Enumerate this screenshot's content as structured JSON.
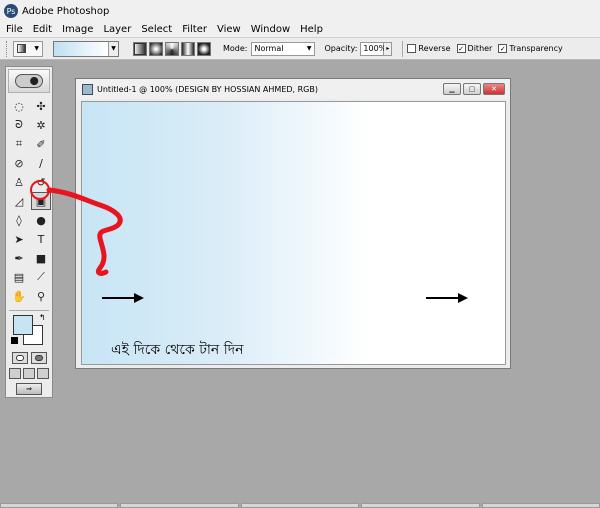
{
  "app": {
    "title": "Adobe Photoshop",
    "icon_label": "Ps"
  },
  "menu": [
    {
      "label": "File"
    },
    {
      "label": "Edit"
    },
    {
      "label": "Image"
    },
    {
      "label": "Layer"
    },
    {
      "label": "Select"
    },
    {
      "label": "Filter"
    },
    {
      "label": "View"
    },
    {
      "label": "Window"
    },
    {
      "label": "Help"
    }
  ],
  "options": {
    "mode_label": "Mode:",
    "mode_value": "Normal",
    "opacity_label": "Opacity:",
    "opacity_value": "100%",
    "reverse_label": "Reverse",
    "reverse_checked": false,
    "dither_label": "Dither",
    "dither_checked": true,
    "transparency_label": "Transparency",
    "transparency_checked": true,
    "gradient_colors": [
      "#bfe0f2",
      "#ffffff"
    ]
  },
  "toolbox": {
    "tools": [
      {
        "name": "marquee-tool-icon",
        "glyph": "◌"
      },
      {
        "name": "move-tool-icon",
        "glyph": "✣"
      },
      {
        "name": "lasso-tool-icon",
        "glyph": "ᘐ"
      },
      {
        "name": "magic-wand-tool-icon",
        "glyph": "✲"
      },
      {
        "name": "crop-tool-icon",
        "glyph": "⌗"
      },
      {
        "name": "slice-tool-icon",
        "glyph": "✐"
      },
      {
        "name": "healing-brush-tool-icon",
        "glyph": "⊘"
      },
      {
        "name": "brush-tool-icon",
        "glyph": "∕"
      },
      {
        "name": "clone-stamp-tool-icon",
        "glyph": "♙"
      },
      {
        "name": "history-brush-tool-icon",
        "glyph": "↺"
      },
      {
        "name": "eraser-tool-icon",
        "glyph": "◿"
      },
      {
        "name": "gradient-tool-icon",
        "glyph": "▣"
      },
      {
        "name": "blur-tool-icon",
        "glyph": "◊"
      },
      {
        "name": "dodge-tool-icon",
        "glyph": "●"
      },
      {
        "name": "path-selection-tool-icon",
        "glyph": "➤"
      },
      {
        "name": "type-tool-icon",
        "glyph": "T"
      },
      {
        "name": "pen-tool-icon",
        "glyph": "✒"
      },
      {
        "name": "shape-tool-icon",
        "glyph": "■"
      },
      {
        "name": "notes-tool-icon",
        "glyph": "▤"
      },
      {
        "name": "eyedropper-tool-icon",
        "glyph": "⟋"
      },
      {
        "name": "hand-tool-icon",
        "glyph": "✋"
      },
      {
        "name": "zoom-tool-icon",
        "glyph": "⚲"
      }
    ],
    "active_tool": "gradient-tool-icon",
    "foreground_color": "#c6e4f4",
    "background_color": "#ffffff",
    "jump_label": "⇒"
  },
  "document": {
    "title": "Untitled-1 @ 100% (DESIGN BY HOSSIAN AHMED, RGB)",
    "minimize_glyph": "▁",
    "maximize_glyph": "▢",
    "close_glyph": "✕",
    "canvas_text": "এই দিকে থেকে টান দিন",
    "gradient_start": "#c7e5f5",
    "gradient_end": "#ffffff",
    "annotation_color": "#e8141e"
  }
}
